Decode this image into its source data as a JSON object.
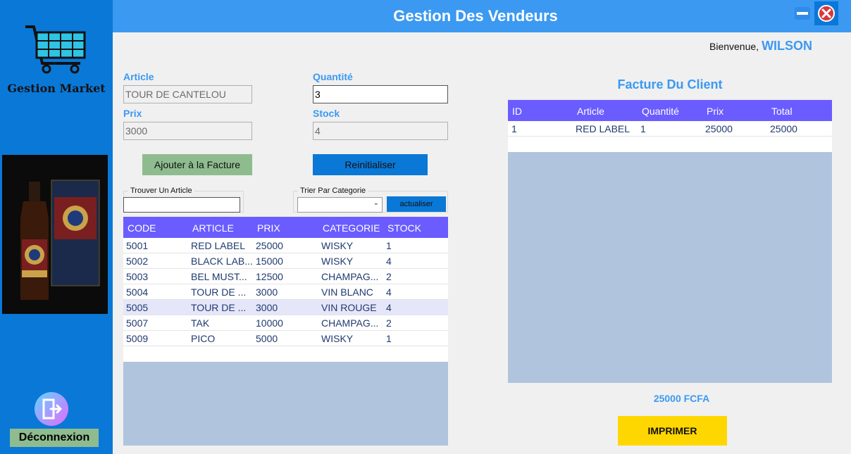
{
  "header": {
    "title": "Gestion Des Vendeurs"
  },
  "sidebar": {
    "brand": "Gestion Market",
    "logout_label": "Déconnexion",
    "icons": {
      "logo": "shopping-cart-icon",
      "logout": "logout-icon"
    }
  },
  "welcome": {
    "label": "Bienvenue,",
    "user": "WILSON"
  },
  "form": {
    "article_label": "Article",
    "article_value": "TOUR DE CANTELOU",
    "quantite_label": "Quantité",
    "quantite_value": "3",
    "prix_label": "Prix",
    "prix_value": "3000",
    "stock_label": "Stock",
    "stock_value": "4",
    "add_button": "Ajouter à la Facture",
    "reset_button": "Reinitialiser"
  },
  "filters": {
    "search_title": "Trouver Un Article",
    "search_value": "",
    "category_title": "Trier Par Categorie",
    "category_value": "",
    "refresh_button": "actualiser"
  },
  "products": {
    "columns": [
      "CODE",
      "ARTICLE",
      "PRIX",
      "CATEGORIE",
      "STOCK"
    ],
    "selected_index": 4,
    "rows": [
      [
        "5001",
        "RED LABEL",
        "25000",
        "WISKY",
        "1"
      ],
      [
        "5002",
        "BLACK LAB...",
        "15000",
        "WISKY",
        "4"
      ],
      [
        "5003",
        "BEL MUST...",
        "12500",
        "CHAMPAG...",
        "2"
      ],
      [
        "5004",
        "TOUR DE ...",
        "3000",
        "VIN BLANC",
        "4"
      ],
      [
        "5005",
        "TOUR DE ...",
        "3000",
        "VIN ROUGE",
        "4"
      ],
      [
        "5007",
        "TAK",
        "10000",
        "CHAMPAG...",
        "2"
      ],
      [
        "5009",
        "PICO",
        "5000",
        "WISKY",
        "1"
      ]
    ]
  },
  "invoice": {
    "title": "Facture Du Client",
    "columns": [
      "ID",
      "Article",
      "Quantité",
      "Prix",
      "Total"
    ],
    "rows": [
      [
        "1",
        "RED LABEL",
        "1",
        "25000",
        "25000"
      ]
    ],
    "total": "25000 FCFA",
    "print_button": "IMPRIMER"
  },
  "colors": {
    "sidebar": "#0a78d7",
    "topbar": "#3b99f2",
    "grid_header": "#6a5cff",
    "grid_empty": "#b0c4de",
    "print": "#ffd700",
    "add": "#8fbc8f"
  }
}
